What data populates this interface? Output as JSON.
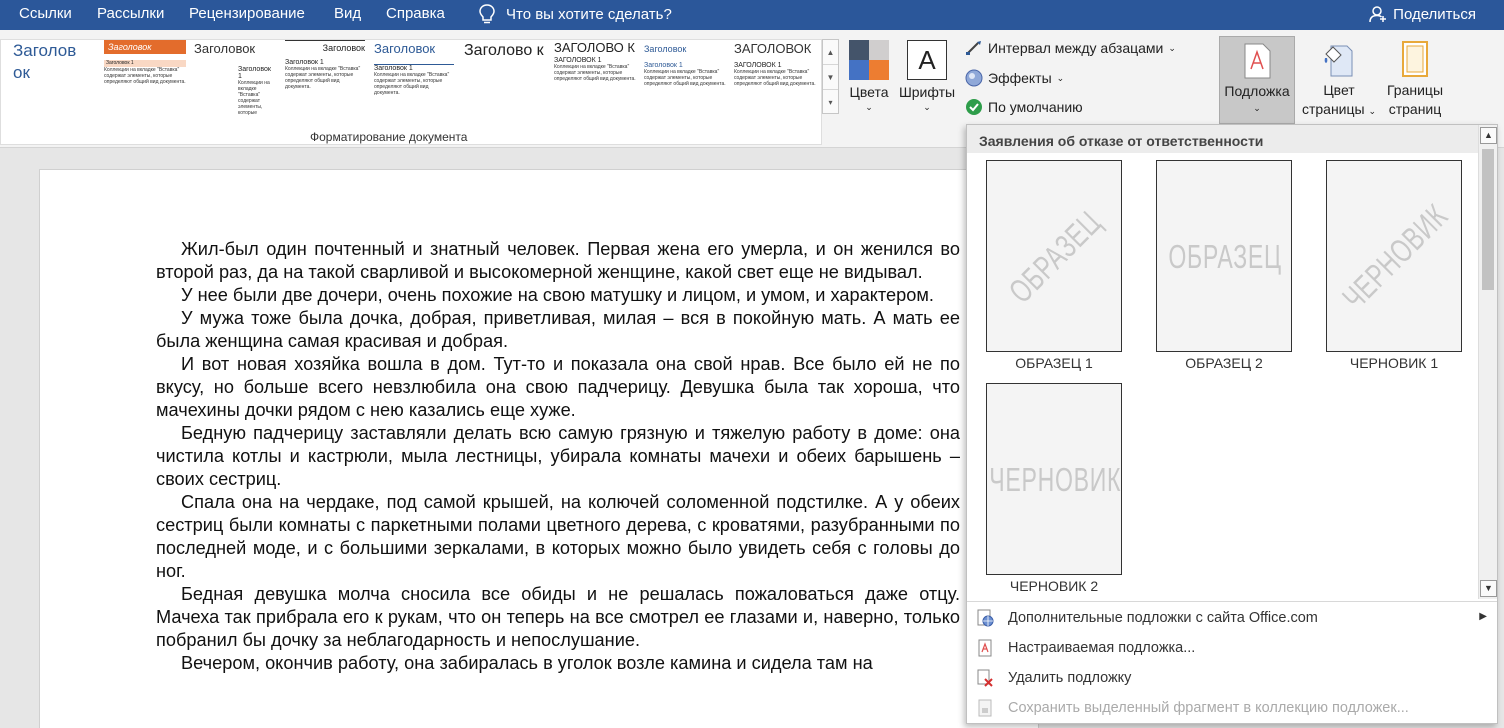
{
  "menubar": {
    "tabs": [
      "Ссылки",
      "Рассылки",
      "Рецензирование",
      "Вид",
      "Справка"
    ],
    "tell_me": "Что вы хотите сделать?",
    "share": "Поделиться"
  },
  "ribbon": {
    "styles": [
      {
        "title": "Заголов ок"
      },
      {
        "title": "Заголовок",
        "sub": "Заголовок 1"
      },
      {
        "title": "Заголовок",
        "sub": "Заголовок 1"
      },
      {
        "title": "Заголовок",
        "sub": "Заголовок 1"
      },
      {
        "title": "Заголовок",
        "sub": "Заголовок 1"
      },
      {
        "title": "Заголово к"
      },
      {
        "title": "ЗАГОЛОВО К",
        "sub": "ЗАГОЛОВОК 1"
      },
      {
        "title": "Заголовок",
        "sub": "Заголовок 1"
      },
      {
        "title": "ЗАГОЛОВОК",
        "sub": "ЗАГОЛОВОК 1"
      }
    ],
    "style_body_text": "Коллекции на вкладке \"Вставка\" содержат элементы, которые определяют общий вид документа.",
    "group_label": "Форматирование документа",
    "colors_label": "Цвета",
    "fonts_label": "Шрифты",
    "fonts_glyph": "A",
    "paragraph_spacing": "Интервал между абзацами",
    "effects": "Эффекты",
    "set_default": "По умолчанию",
    "watermark_label": "Подложка",
    "page_color_label": [
      "Цвет",
      "страницы"
    ],
    "page_borders_label": [
      "Границы",
      "страниц"
    ]
  },
  "document": {
    "paragraphs": [
      "Жил-был один почтенный и знатный человек. Первая жена его умерла, и он женился во второй раз, да на такой сварливой и высокомерной женщине, какой свет еще не видывал.",
      "У нее были две дочери, очень похожие на свою матушку и лицом, и умом, и характером.",
      "У мужа тоже была дочка, добрая, приветливая, милая – вся в покойную мать. А мать ее была женщина самая красивая и добрая.",
      "И вот новая хозяйка вошла в дом. Тут-то и показала она свой нрав. Все было ей не по вкусу, но больше всего невзлюбила она свою падчерицу. Девушка была так хороша, что мачехины дочки рядом с нею казались еще хуже.",
      "Бедную падчерицу заставляли делать всю самую грязную и тяжелую работу в доме: она чистила котлы и кастрюли, мыла лестницы, убирала комнаты мачехи и обеих барышень – своих сестриц.",
      "Спала она на чердаке, под самой крышей, на колючей соломенной подстилке. А у обеих сестриц были комнаты с паркетными полами цветного дерева, с кроватями, разубранными по последней моде, и с большими зеркалами, в которых можно было увидеть себя с головы до ног.",
      "Бедная девушка молча сносила все обиды и не решалась пожаловаться даже отцу. Мачеха так прибрала его к рукам, что он теперь на все смотрел ее глазами и, наверно, только побранил бы дочку за неблагодарность и непослушание.",
      "Вечером, окончив работу, она забиралась в уголок возле камина и сидела там на"
    ]
  },
  "watermark_panel": {
    "header": "Заявления об отказе от ответственности",
    "items": [
      {
        "label": "ОБРАЗЕЦ 1",
        "text": "ОБРАЗЕЦ"
      },
      {
        "label": "ОБРАЗЕЦ 2",
        "text": "ОБРАЗЕЦ"
      },
      {
        "label": "ЧЕРНОВИК 1",
        "text": "ЧЕРНОВИК"
      },
      {
        "label": "ЧЕРНОВИК 2",
        "text": "ЧЕРНОВИК"
      }
    ],
    "menu": [
      {
        "label": "Дополнительные подложки с сайта Office.com",
        "icon": "globe-watermark-icon",
        "submenu": true,
        "enabled": true
      },
      {
        "label": "Настраиваемая подложка...",
        "icon": "custom-watermark-icon",
        "enabled": true
      },
      {
        "label": "Удалить подложку",
        "icon": "remove-watermark-icon",
        "enabled": true
      },
      {
        "label": "Сохранить выделенный фрагмент в коллекцию подложек...",
        "icon": "save-watermark-icon",
        "enabled": false
      }
    ]
  },
  "colors": {
    "menubar_bg": "#2b579a",
    "accent_blue": "#2e5a96"
  }
}
